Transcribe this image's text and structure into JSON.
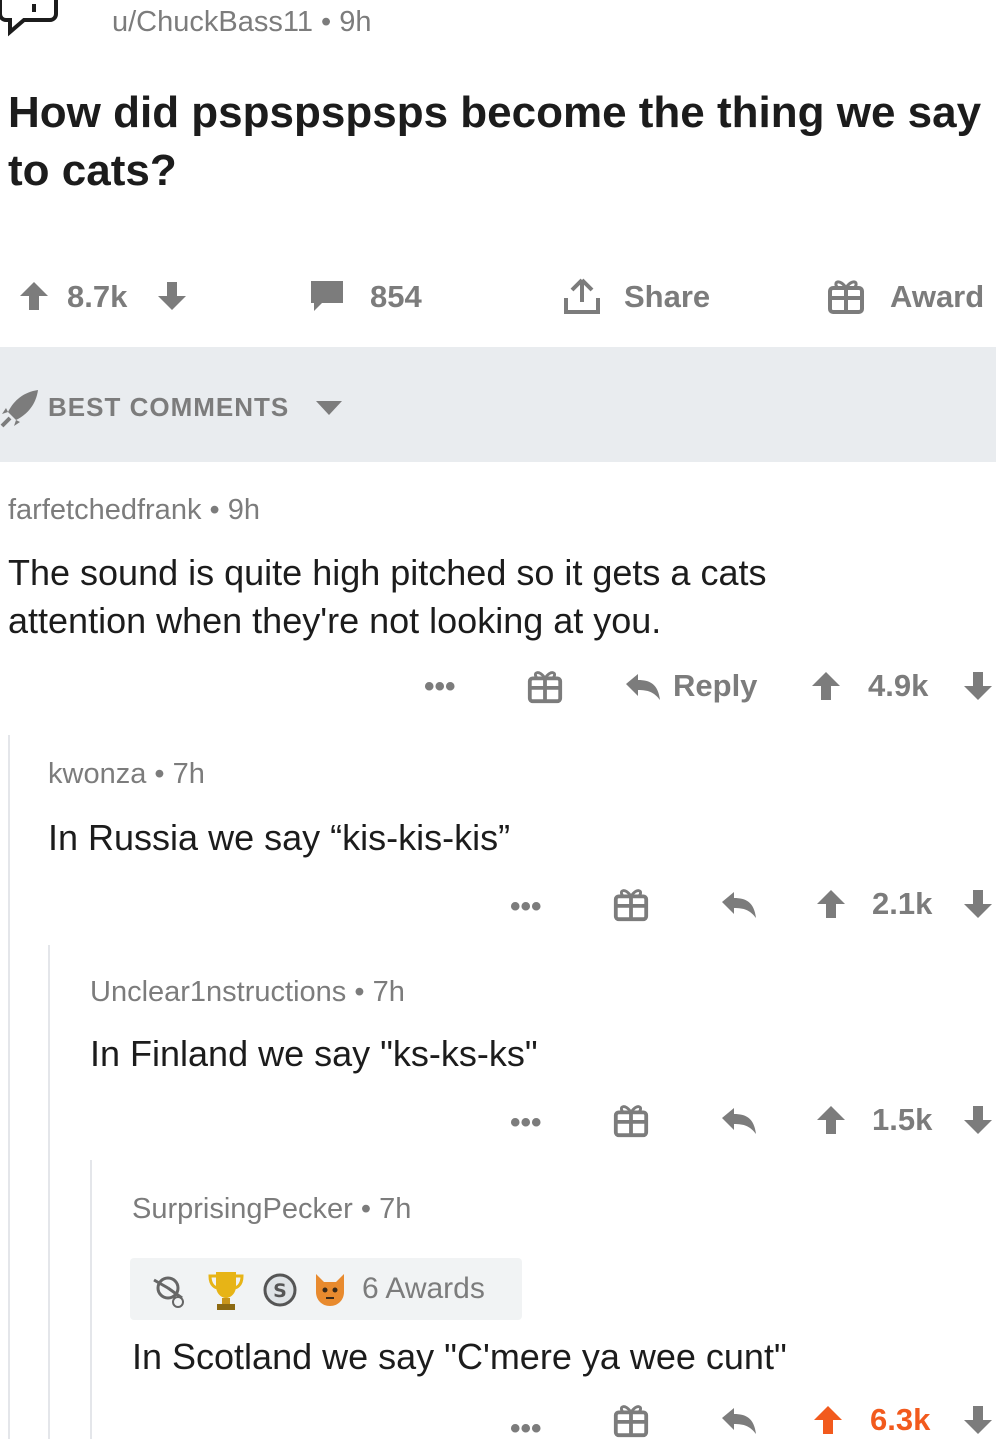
{
  "post": {
    "author": "u/ChuckBass11",
    "age": "9h",
    "title": "How did pspspspsps become the thing we say to cats?",
    "score": "8.7k",
    "comments": "854",
    "share_label": "Share",
    "award_label": "Award"
  },
  "sort": {
    "label": "BEST COMMENTS"
  },
  "comments": [
    {
      "author": "farfetchedfrank",
      "age": "9h",
      "text": "The sound is quite high pitched so it gets a cats attention when they're not looking at you.",
      "reply_label": "Reply",
      "score": "4.9k"
    },
    {
      "author": "kwonza",
      "age": "7h",
      "text": "In Russia we say “kis-kis-kis”",
      "score": "2.1k"
    },
    {
      "author": "Unclear1nstructions",
      "age": "7h",
      "text": "In Finland we say \"ks-ks-ks\"",
      "score": "1.5k"
    },
    {
      "author": "SurprisingPecker",
      "age": "7h",
      "awards_label": "6 Awards",
      "text": "In Scotland we say \"C'mere ya wee cunt\"",
      "score": "6.3k",
      "score_color": "#f25a1d"
    }
  ],
  "colors": {
    "accent_upvote": "#f25a1d",
    "muted": "#7c7c7c",
    "band": "#e9ecef"
  }
}
